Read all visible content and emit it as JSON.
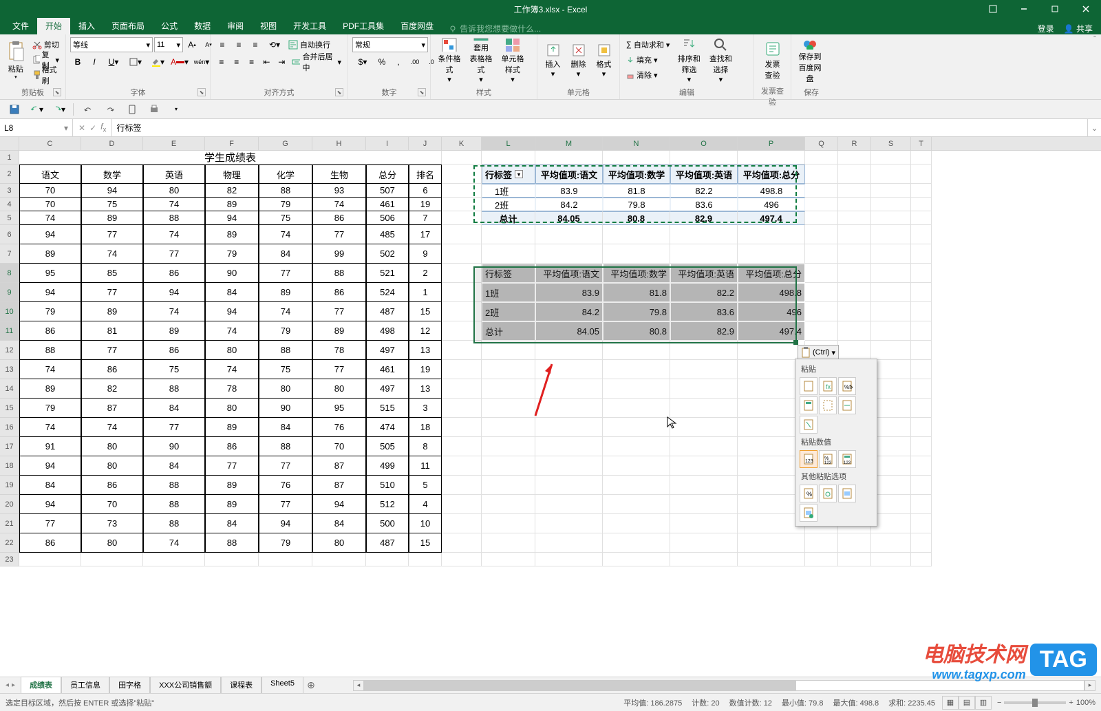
{
  "title": "工作簿3.xlsx - Excel",
  "menu": {
    "file": "文件",
    "home": "开始",
    "insert": "插入",
    "layout": "页面布局",
    "formula": "公式",
    "data": "数据",
    "review": "审阅",
    "view": "视图",
    "dev": "开发工具",
    "pdf": "PDF工具集",
    "baidu": "百度网盘",
    "tellme": "告诉我您想要做什么...",
    "login": "登录",
    "share": "共享"
  },
  "ribbon": {
    "clipboard": {
      "label": "剪贴板",
      "paste": "粘贴",
      "cut": "剪切",
      "copy": "复制",
      "painter": "格式刷"
    },
    "font": {
      "label": "字体",
      "name": "等线",
      "size": "11"
    },
    "align": {
      "label": "对齐方式",
      "wrap": "自动换行",
      "merge": "合并后居中"
    },
    "number": {
      "label": "数字",
      "format": "常规"
    },
    "styles": {
      "label": "样式",
      "cond": "条件格式",
      "table": "套用\n表格格式",
      "cell": "单元格样式"
    },
    "cells": {
      "label": "单元格",
      "insert": "插入",
      "delete": "删除",
      "format": "格式"
    },
    "editing": {
      "label": "编辑",
      "sum": "自动求和",
      "fill": "填充",
      "clear": "清除",
      "sort": "排序和筛选",
      "find": "查找和选择"
    },
    "invoice": {
      "label": "发票查验",
      "btn": "发票\n查验"
    },
    "save": {
      "label": "保存",
      "btn": "保存到\n百度网盘"
    }
  },
  "namebox": "L8",
  "formula": "行标签",
  "cols": [
    "C",
    "D",
    "E",
    "F",
    "G",
    "H",
    "I",
    "J",
    "K",
    "L",
    "M",
    "N",
    "O",
    "P",
    "Q",
    "R",
    "S",
    "T"
  ],
  "table": {
    "title": "学生成绩表",
    "headers": [
      "语文",
      "数学",
      "英语",
      "物理",
      "化学",
      "生物",
      "总分",
      "排名"
    ],
    "rows": [
      [
        "70",
        "94",
        "80",
        "82",
        "88",
        "93",
        "507",
        "6"
      ],
      [
        "70",
        "75",
        "74",
        "89",
        "79",
        "74",
        "461",
        "19"
      ],
      [
        "74",
        "89",
        "88",
        "94",
        "75",
        "86",
        "506",
        "7"
      ],
      [
        "94",
        "77",
        "74",
        "89",
        "74",
        "77",
        "485",
        "17"
      ],
      [
        "89",
        "74",
        "77",
        "79",
        "84",
        "99",
        "502",
        "9"
      ],
      [
        "95",
        "85",
        "86",
        "90",
        "77",
        "88",
        "521",
        "2"
      ],
      [
        "94",
        "77",
        "94",
        "84",
        "89",
        "86",
        "524",
        "1"
      ],
      [
        "79",
        "89",
        "74",
        "94",
        "74",
        "77",
        "487",
        "15"
      ],
      [
        "86",
        "81",
        "89",
        "74",
        "79",
        "89",
        "498",
        "12"
      ],
      [
        "88",
        "77",
        "86",
        "80",
        "88",
        "78",
        "497",
        "13"
      ],
      [
        "74",
        "86",
        "75",
        "74",
        "75",
        "77",
        "461",
        "19"
      ],
      [
        "89",
        "82",
        "88",
        "78",
        "80",
        "80",
        "497",
        "13"
      ],
      [
        "79",
        "87",
        "84",
        "80",
        "90",
        "95",
        "515",
        "3"
      ],
      [
        "74",
        "74",
        "77",
        "89",
        "84",
        "76",
        "474",
        "18"
      ],
      [
        "91",
        "80",
        "90",
        "86",
        "88",
        "70",
        "505",
        "8"
      ],
      [
        "94",
        "80",
        "84",
        "77",
        "77",
        "87",
        "499",
        "11"
      ],
      [
        "84",
        "86",
        "88",
        "89",
        "76",
        "87",
        "510",
        "5"
      ],
      [
        "94",
        "70",
        "88",
        "89",
        "77",
        "94",
        "512",
        "4"
      ],
      [
        "77",
        "73",
        "88",
        "84",
        "94",
        "84",
        "500",
        "10"
      ],
      [
        "86",
        "80",
        "74",
        "88",
        "79",
        "80",
        "487",
        "15"
      ]
    ]
  },
  "pivot": {
    "headers": [
      "行标签",
      "平均值项:语文",
      "平均值项:数学",
      "平均值项:英语",
      "平均值项:总分"
    ],
    "rows": [
      [
        "1班",
        "83.9",
        "81.8",
        "82.2",
        "498.8"
      ],
      [
        "2班",
        "84.2",
        "79.8",
        "83.6",
        "496"
      ]
    ],
    "total": [
      "总计",
      "84.05",
      "80.8",
      "82.9",
      "497.4"
    ]
  },
  "pasted": {
    "headers": [
      "行标签",
      "平均值项:语文",
      "平均值项:数学",
      "平均值项:英语",
      "平均值项:总分"
    ],
    "rows": [
      [
        "1班",
        "83.9",
        "81.8",
        "82.2",
        "498.8"
      ],
      [
        "2班",
        "84.2",
        "79.8",
        "83.6",
        "496"
      ]
    ],
    "total": [
      "总计",
      "84.05",
      "80.8",
      "82.9",
      "497.4"
    ]
  },
  "pasteopt": {
    "btn": "(Ctrl)",
    "sect1": "粘贴",
    "sect2": "粘贴数值",
    "sect3": "其他粘贴选项"
  },
  "sheets": [
    "成绩表",
    "员工信息",
    "田字格",
    "XXX公司销售额",
    "课程表",
    "Sheet5"
  ],
  "status": {
    "msg": "选定目标区域，然后按 ENTER 或选择\"粘贴\"",
    "avg": "平均值: 186.2875",
    "count": "计数: 20",
    "numcount": "数值计数: 12",
    "min": "最小值: 79.8",
    "max": "最大值: 498.8",
    "sum": "求和: 2235.45",
    "zoom": "100%"
  },
  "watermark": {
    "txt": "电脑技术网",
    "tag": "TAG",
    "url": "www.tagxp.com"
  }
}
